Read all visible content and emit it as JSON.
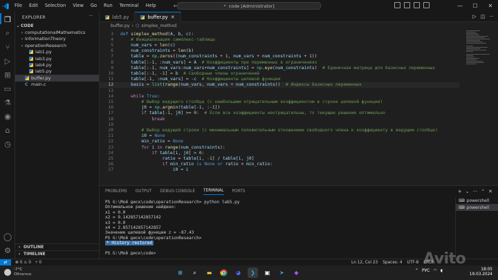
{
  "titlebar": {
    "menu": [
      "File",
      "Edit",
      "Selection",
      "View",
      "Go",
      "Run",
      "Terminal",
      "Help"
    ],
    "search_text": "code [Administrator]"
  },
  "sidebar": {
    "title": "EXPLORER",
    "root": "CODE",
    "items": [
      {
        "label": "computationalMathematics",
        "kind": "folder",
        "indent": 1
      },
      {
        "label": "informationTheory",
        "kind": "folder",
        "indent": 1
      },
      {
        "label": "operationResearch",
        "kind": "folder-open",
        "indent": 1
      },
      {
        "label": "lab1.py",
        "kind": "py",
        "indent": 2
      },
      {
        "label": "lab3.py",
        "kind": "py",
        "indent": 2
      },
      {
        "label": "lab4.py",
        "kind": "py",
        "indent": 2
      },
      {
        "label": "lab5.py",
        "kind": "py",
        "indent": 2
      },
      {
        "label": "buffer.py",
        "kind": "py",
        "indent": 1,
        "selected": true
      },
      {
        "label": "main.c",
        "kind": "c",
        "indent": 1
      }
    ],
    "outline": "OUTLINE",
    "timeline": "TIMELINE"
  },
  "tabs": [
    {
      "label": "lab5.py",
      "active": false
    },
    {
      "label": "buffer.py",
      "active": true
    }
  ],
  "breadcrumb": [
    "buffer.py",
    "simplex_method"
  ],
  "code": [
    {
      "n": "3",
      "html": "<span class='kw'>def</span> <span class='fn'>simplex_method</span>(<span class='var'>A</span>, <span class='var'>b</span>, <span class='var'>c</span>):"
    },
    {
      "n": "4",
      "html": "    <span class='cm'># Инициализация симплекс-таблицы</span>"
    },
    {
      "n": "5",
      "html": "    <span class='var'>num_vars</span> = <span class='fn'>len</span>(<span class='var'>c</span>)"
    },
    {
      "n": "6",
      "html": "    <span class='var'>num_constraints</span> = <span class='fn'>len</span>(<span class='var'>b</span>)"
    },
    {
      "n": "7",
      "html": "    <span class='var'>table</span> = <span class='bi'>np</span>.<span class='fn'>zeros</span>((<span class='var'>num_constraints</span> + <span class='num'>1</span>, <span class='var'>num_vars</span> + <span class='var'>num_constraints</span> + <span class='num'>1</span>))"
    },
    {
      "n": "8",
      "html": "    <span class='var'>table</span>[:<span class='num'>-1</span>, :<span class='var'>num_vars</span>] = <span class='var'>A</span>  <span class='cm'># Коэффициенты при переменных в ограничениях</span>"
    },
    {
      "n": "9",
      "html": "    <span class='var'>table</span>[:<span class='num'>-1</span>, <span class='var'>num_vars</span>:<span class='var'>num_vars</span>+<span class='var'>num_constraints</span>] = <span class='bi'>np</span>.<span class='fn'>eye</span>(<span class='var'>num_constraints</span>)  <span class='cm'># Единичная матрица для базисных переменных</span>"
    },
    {
      "n": "10",
      "html": "    <span class='var'>table</span>[:<span class='num'>-1</span>, <span class='num'>-1</span>] = <span class='var'>b</span>  <span class='cm'># Свободные члены ограничений</span>"
    },
    {
      "n": "11",
      "html": "    <span class='var'>table</span>[<span class='num'>-1</span>, :<span class='var'>num_vars</span>] = -<span class='var'>c</span>  <span class='cm'># Коэффициенты целевой функции</span>"
    },
    {
      "n": "12",
      "html": "    <span class='var'>basis</span> = <span class='bi'>list</span>(<span class='fn'>range</span>(<span class='var'>num_vars</span>, <span class='var'>num_vars</span> + <span class='var'>num_constraints</span>))  <span class='cm'># Индексы базисных переменных</span>",
      "current": true
    },
    {
      "n": "13",
      "html": ""
    },
    {
      "n": "14",
      "html": "    <span class='ctl'>while</span> <span class='kw'>True</span>:"
    },
    {
      "n": "15",
      "html": "        <span class='cm'># Выбор ведущего столбца (с наибольшим отрицательным коэффициентом в строке целевой функции)</span>"
    },
    {
      "n": "16",
      "html": "        <span class='var'>j0</span> = <span class='bi'>np</span>.<span class='fn'>argmin</span>(<span class='var'>table</span>[<span class='num'>-1</span>, :<span class='num'>-1</span>])"
    },
    {
      "n": "17",
      "html": "        <span class='ctl'>if</span> <span class='var'>table</span>[<span class='num'>-1</span>, <span class='var'>j0</span>] &gt;= <span class='num'>0</span>:  <span class='cm'># Если все коэффициенты неотрицательны, то текущее решение оптимально</span>"
    },
    {
      "n": "18",
      "html": "            <span class='ctl'>break</span>"
    },
    {
      "n": "19",
      "html": ""
    },
    {
      "n": "20",
      "html": "        <span class='cm'># Выбор ведущей строки (с минимальным положительным отношением свободного члена к коэффициенту в ведущем столбце)</span>"
    },
    {
      "n": "21",
      "html": "        <span class='var'>i0</span> = <span class='kw'>None</span>"
    },
    {
      "n": "22",
      "html": "        <span class='var'>min_ratio</span> = <span class='kw'>None</span>"
    },
    {
      "n": "23",
      "html": "        <span class='ctl'>for</span> <span class='var'>i</span> <span class='ctl'>in</span> <span class='fn'>range</span>(<span class='var'>num_constraints</span>):"
    },
    {
      "n": "24",
      "html": "            <span class='ctl'>if</span> <span class='var'>table</span>[<span class='var'>i</span>, <span class='var'>j0</span>] &gt; <span class='num'>0</span>:"
    },
    {
      "n": "25",
      "html": "                <span class='var'>ratio</span> = <span class='var'>table</span>[<span class='var'>i</span>, <span class='num'>-1</span>] / <span class='var'>table</span>[<span class='var'>i</span>, <span class='var'>j0</span>]"
    },
    {
      "n": "26",
      "html": "                <span class='ctl'>if</span> <span class='var'>min_ratio</span> <span class='kw'>is</span> <span class='kw'>None</span> <span class='kw'>or</span> <span class='var'>ratio</span> &lt; <span class='var'>min_ratio</span>:"
    },
    {
      "n": "27",
      "html": "                    <span class='var'>i0</span> = <span class='var'>i</span>"
    }
  ],
  "panel": {
    "tabs": [
      {
        "label": "PROBLEMS",
        "active": false
      },
      {
        "label": "OUTPUT",
        "active": false
      },
      {
        "label": "DEBUG CONSOLE",
        "active": false
      },
      {
        "label": "TERMINAL",
        "active": true
      },
      {
        "label": "PORTS",
        "active": false
      }
    ],
    "terminal_lines": [
      "PS G:\\Мой диск\\code\\operationResearch> python lab5.py",
      "Оптимальное решение найдено:",
      "x1 = 0.0",
      "x2 = 9.142857142857142",
      "x3 = 0.0",
      "x4 = 2.857142857142857",
      "Значение целевой функции z = -87.43",
      "PS G:\\Мой диск\\code\\operationResearch>"
    ],
    "restored_label": "History restored",
    "last_prompt": "PS G:\\Мой диск\\code>",
    "terminal_list": [
      "powershell",
      "powershell"
    ]
  },
  "statusbar": {
    "errors": "0",
    "warnings": "0",
    "ports": "0",
    "position": "Ln 12, Col 23",
    "spaces": "Spaces: 4",
    "encoding": "UTF-8",
    "eol": "CRLF"
  },
  "taskbar": {
    "weather_temp": "-7°C",
    "weather_desc": "Облачно",
    "lang": "РУС",
    "time": "18:05",
    "date": "19.03.2024"
  },
  "watermark": "Avito"
}
